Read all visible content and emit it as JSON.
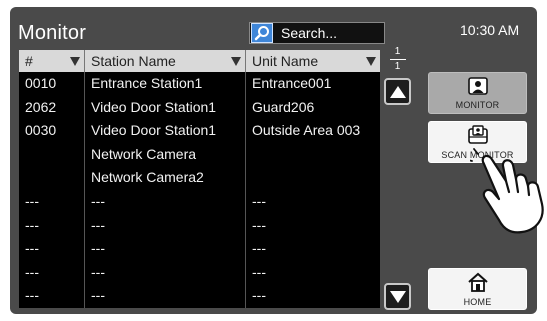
{
  "header": {
    "title": "Monitor",
    "search_placeholder": "Search...",
    "clock": "10:30 AM",
    "page_current": "1",
    "page_total": "1"
  },
  "table": {
    "columns": [
      {
        "label": "#"
      },
      {
        "label": "Station Name"
      },
      {
        "label": "Unit Name"
      }
    ],
    "rows": [
      {
        "num": "0010",
        "station": "Entrance Station1",
        "unit": "Entrance001"
      },
      {
        "num": "2062",
        "station": "Video Door Station1",
        "unit": "Guard206"
      },
      {
        "num": "0030",
        "station": "Video Door Station1",
        "unit": "Outside Area 003"
      },
      {
        "num": "",
        "station": "Network Camera",
        "unit": ""
      },
      {
        "num": "",
        "station": "Network Camera2",
        "unit": ""
      },
      {
        "num": "---",
        "station": "---",
        "unit": "---"
      },
      {
        "num": "---",
        "station": "---",
        "unit": "---"
      },
      {
        "num": "---",
        "station": "---",
        "unit": "---"
      },
      {
        "num": "---",
        "station": "---",
        "unit": "---"
      },
      {
        "num": "---",
        "station": "---",
        "unit": "---"
      }
    ]
  },
  "sidebar": {
    "monitor_label": "MONITOR",
    "scan_monitor_label": "SCAN MONITOR",
    "home_label": "HOME"
  },
  "icons": {
    "search": "search-icon",
    "monitor": "monitor-icon",
    "scan_monitor": "scan-monitor-icon",
    "home": "home-icon",
    "scroll_up": "arrow-up-icon",
    "scroll_down": "arrow-down-icon",
    "hand": "pointing-hand-icon"
  }
}
